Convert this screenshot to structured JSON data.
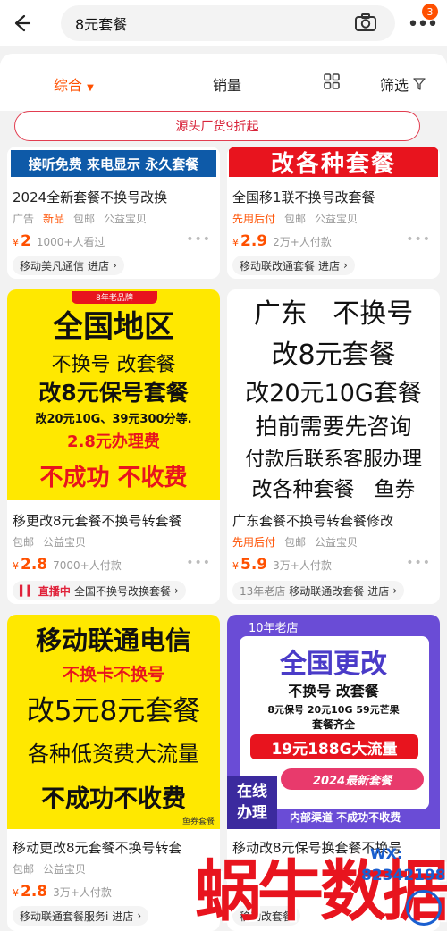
{
  "header": {
    "search_query": "8元套餐",
    "badge_count": "3"
  },
  "tabs": {
    "overall": "综合",
    "sales": "销量",
    "filter": "筛选"
  },
  "banner": "源头厂货9折起",
  "products": [
    {
      "image_text": [
        "接听免费 来电显示 永久套餐"
      ],
      "title": "2024全新套餐不换号改换",
      "tags": [
        "广告",
        "新品",
        "包邮",
        "公益宝贝"
      ],
      "price": "2",
      "sold": "1000+人看过",
      "shop": "移动美凡通信",
      "shop_link": "进店"
    },
    {
      "image_text": [
        "改各种套餐"
      ],
      "title": "全国移1联不换号改套餐",
      "tags": [
        "先用后付",
        "包邮",
        "公益宝贝"
      ],
      "price": "2.9",
      "sold": "2万+人付款",
      "shop": "移动联改通套餐",
      "shop_link": "进店"
    },
    {
      "image_text": [
        "8年老品牌",
        "全国地区",
        "不换号 改套餐",
        "改8元保号套餐",
        "改20元10G、39元300分等.",
        "2.8元办理费",
        "不成功 不收费"
      ],
      "title": "移更改8元套餐不换号转套餐",
      "tags": [
        "包邮",
        "公益宝贝"
      ],
      "price": "2.8",
      "sold": "7000+人付款",
      "live": "直播中",
      "shop": "全国不换号改换套餐"
    },
    {
      "image_text": [
        "广东   不换号",
        "改8元套餐",
        "改20元10G套餐",
        "拍前需要先咨询",
        "付款后联系客服办理",
        "改各种套餐   鱼券"
      ],
      "title": "广东套餐不换号转套餐修改",
      "tags": [
        "先用后付",
        "包邮",
        "公益宝贝"
      ],
      "price": "5.9",
      "sold": "3万+人付款",
      "shop_prefix": "13年老店",
      "shop": "移动联通改套餐",
      "shop_link": "进店"
    },
    {
      "image_text": [
        "移动联通电信",
        "不换卡不换号",
        "改5元8元套餐",
        "各种低资费大流量",
        "不成功不收费",
        "鱼券套餐"
      ],
      "title": "移动更改8元套餐不换号转套",
      "tags": [
        "包邮",
        "公益宝贝"
      ],
      "price": "2.8",
      "sold": "3万+人付款",
      "shop": "移动联通套餐服务i",
      "shop_link": "进店"
    },
    {
      "image_text": [
        "10年老店",
        "全国更改",
        "不换号 改套餐",
        "8元保号 20元10G 59元芒果",
        "套餐齐全",
        "19元188G大流量",
        "2024最新套餐",
        "在线",
        "办理",
        "内部渠道 不成功不收费"
      ],
      "title": "移动改8元保号换套餐不换号",
      "shop": "移动改套餐"
    }
  ],
  "watermark": {
    "brand": "蜗牛数据",
    "wx": "WX:",
    "id": "82342198"
  },
  "colors": {
    "accent": "#ff5000",
    "yellow": "#ffe800",
    "red": "#e8141e",
    "purple": "#6a4cd6"
  }
}
